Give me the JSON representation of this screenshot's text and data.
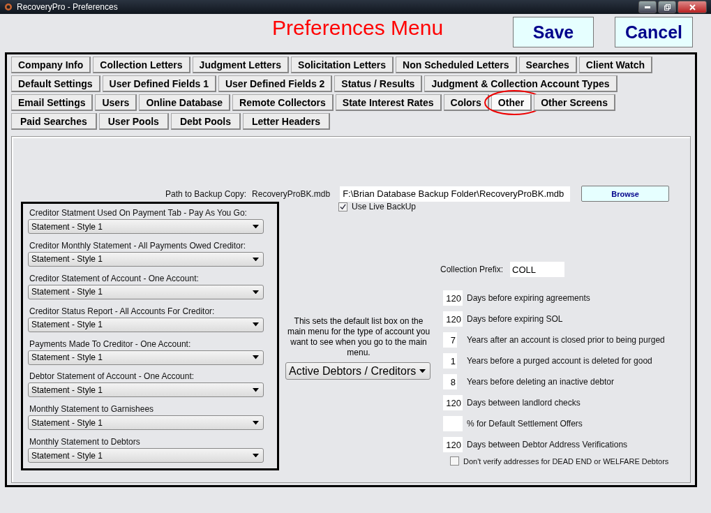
{
  "window": {
    "title": "RecoveryPro - Preferences"
  },
  "header": {
    "title": "Preferences Menu",
    "buttons": [
      "Save",
      "Cancel"
    ]
  },
  "tab_rows": [
    [
      {
        "label": "Company Info",
        "selected": false
      },
      {
        "label": "Collection Letters",
        "selected": false
      },
      {
        "label": "Judgment Letters",
        "selected": false
      },
      {
        "label": "Solicitation Letters",
        "selected": false
      },
      {
        "label": "Non Scheduled Letters",
        "selected": false
      },
      {
        "label": "Searches",
        "selected": false
      },
      {
        "label": "Client Watch",
        "selected": false
      }
    ],
    [
      {
        "label": "Default Settings",
        "selected": false
      },
      {
        "label": "User Defined Fields 1",
        "selected": false
      },
      {
        "label": "User Defined Fields 2",
        "selected": false
      },
      {
        "label": "Status / Results",
        "selected": false
      },
      {
        "label": "Judgment & Collection Account Types",
        "selected": false
      }
    ],
    [
      {
        "label": "Email Settings",
        "selected": false
      },
      {
        "label": "Users",
        "selected": false
      },
      {
        "label": "Online Database",
        "selected": false
      },
      {
        "label": "Remote Collectors",
        "selected": false
      },
      {
        "label": "State Interest Rates",
        "selected": false
      },
      {
        "label": "Colors",
        "selected": false
      },
      {
        "label": "Other",
        "selected": true
      },
      {
        "label": "Other Screens",
        "selected": false
      }
    ],
    [
      {
        "label": "Paid Searches",
        "selected": false
      },
      {
        "label": "User Pools",
        "selected": false
      },
      {
        "label": "Debt Pools",
        "selected": false
      },
      {
        "label": "Letter Headers",
        "selected": false
      }
    ]
  ],
  "backup": {
    "label": "Path to Backup Copy:",
    "file": "RecoveryProBK.mdb",
    "path": "F:\\Brian Database Backup Folder\\RecoveryProBK.mdb",
    "button": "Browse",
    "live_backup": {
      "label": "Use Live BackUp",
      "checked": true
    }
  },
  "statements": [
    {
      "label": "Creditor Statment Used On Payment Tab - Pay As You Go:",
      "value": "Statement - Style 1"
    },
    {
      "label": "Creditor Monthly Statement - All Payments Owed Creditor:",
      "value": "Statement - Style 1"
    },
    {
      "label": "Creditor Statement of Account - One Account:",
      "value": "Statement - Style 1"
    },
    {
      "label": "Creditor Status Report - All Accounts For Creditor:",
      "value": "Statement - Style 1"
    },
    {
      "label": "Payments Made To Creditor - One Account:",
      "value": "Statement - Style 1"
    },
    {
      "label": "Debtor Statement of Account - One Account:",
      "value": "Statement - Style 1"
    },
    {
      "label": "Monthly Statement to Garnishees",
      "value": "Statement - Style 1"
    },
    {
      "label": "Monthly Statement to Debtors",
      "value": "Statement - Style 1"
    }
  ],
  "default_list": {
    "description": "This sets the default list box on the main menu for the type of account you want to see when you go to the main menu.",
    "value": "Active Debtors / Creditors"
  },
  "collection_prefix": {
    "label": "Collection Prefix:",
    "value": "COLL"
  },
  "settings": [
    {
      "value": "120",
      "label": "Days before expiring agreements"
    },
    {
      "value": "120",
      "label": "Days before expiring SOL"
    },
    {
      "value": "7",
      "label": "Years after an account is closed prior to being purged"
    },
    {
      "value": "1",
      "label": "Years before a purged account is deleted for good"
    },
    {
      "value": "8",
      "label": "Years before deleting an inactive debtor"
    },
    {
      "value": "120",
      "label": "Days between landlord checks"
    },
    {
      "label": "% for Default Settlement Offers"
    },
    {
      "value": "120",
      "label": "Days between Debtor Address Verifications"
    }
  ],
  "dont_verify": {
    "label": "Don't verify addresses for DEAD END or WELFARE Debtors",
    "checked": false
  }
}
